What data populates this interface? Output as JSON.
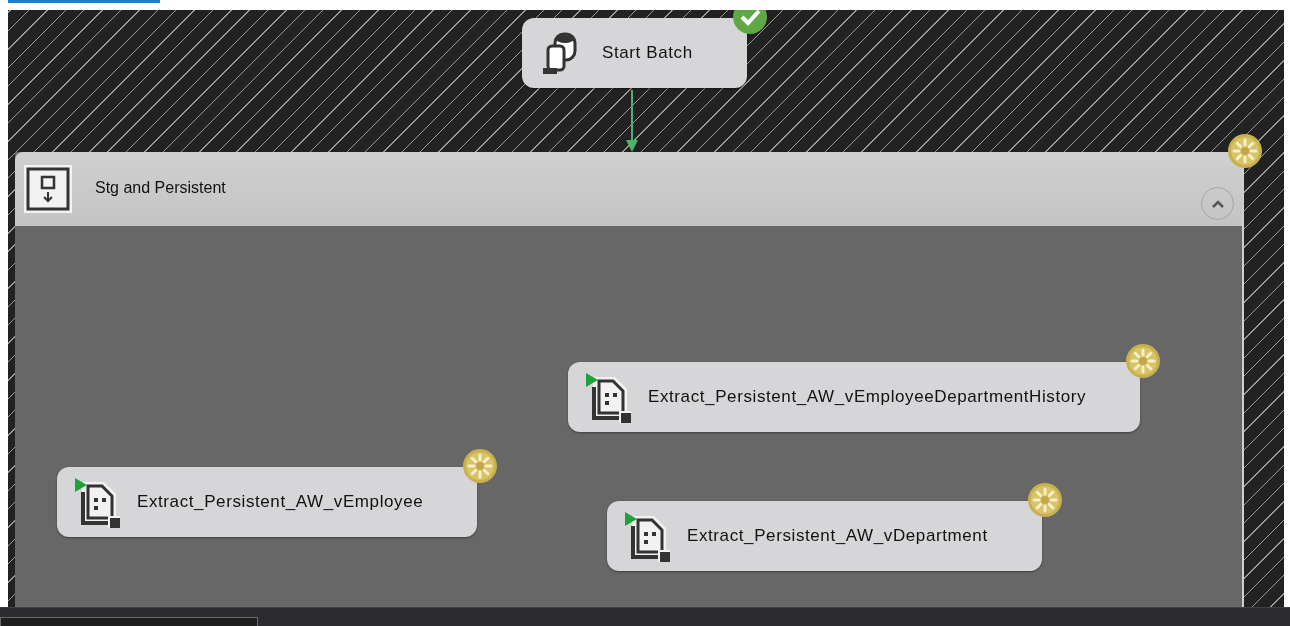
{
  "canvas": {
    "start_task": {
      "label": "Start Batch",
      "running": false
    },
    "container": {
      "title": "Stg and Persistent",
      "running": true,
      "expanded": true,
      "tasks": [
        {
          "label": "Extract_Persistent_AW_vEmployeeDepartmentHistory",
          "running": true
        },
        {
          "label": "Extract_Persistent_AW_vEmployee",
          "running": true
        },
        {
          "label": "Extract_Persistent_AW_vDepartment",
          "running": true
        }
      ]
    }
  }
}
